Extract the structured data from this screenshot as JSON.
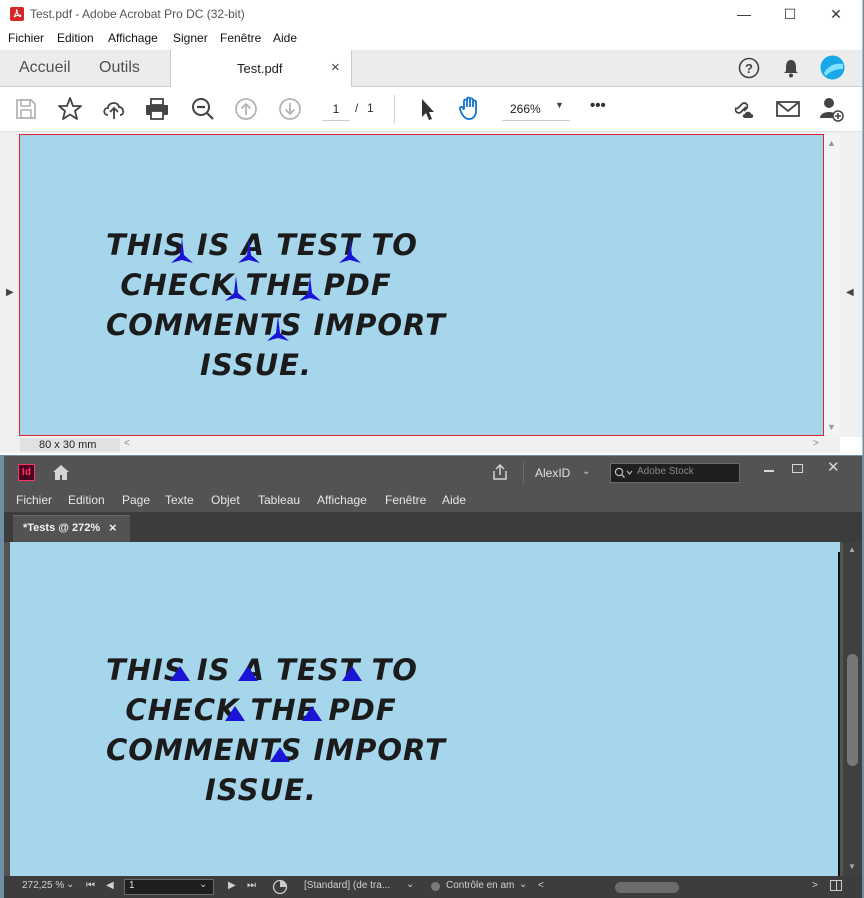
{
  "acrobat": {
    "title": "Test.pdf - Adobe Acrobat Pro DC (32-bit)",
    "menu": [
      "Fichier",
      "Edition",
      "Affichage",
      "Signer",
      "Fenêtre",
      "Aide"
    ],
    "tabs": {
      "home": "Accueil",
      "tools": "Outils",
      "document": "Test.pdf",
      "close": "×"
    },
    "page_current": "1",
    "page_separator": "/",
    "page_total": "1",
    "zoom": "266%",
    "more": "•••",
    "page_size": "80 x 30 mm",
    "page_text": [
      "THIS IS A TEST TO",
      "CHECK THE PDF",
      "COMMENTS IMPORT",
      "ISSUE."
    ]
  },
  "indesign": {
    "app_badge": "Id",
    "user": "AlexID",
    "search_placeholder": "Adobe Stock",
    "menu": [
      "Fichier",
      "Edition",
      "Page",
      "Texte",
      "Objet",
      "Tableau",
      "Affichage",
      "Fenêtre",
      "Aide"
    ],
    "doc_tab": "*Tests @ 272%",
    "doc_tab_close": "×",
    "page_text": [
      "THIS IS A TEST TO",
      "CHECK THE PDF",
      "COMMENTS IMPORT",
      "ISSUE."
    ],
    "status": {
      "zoom": "272,25 %",
      "page": "1",
      "style": "[Standard] (de tra...",
      "preflight": "Contrôle en am"
    }
  },
  "colors": {
    "page_background": "#a5d6ec",
    "comment_marker": "#1a14d6",
    "acrobat_page_border": "#e0242d",
    "indesign_chrome": "#535353"
  }
}
